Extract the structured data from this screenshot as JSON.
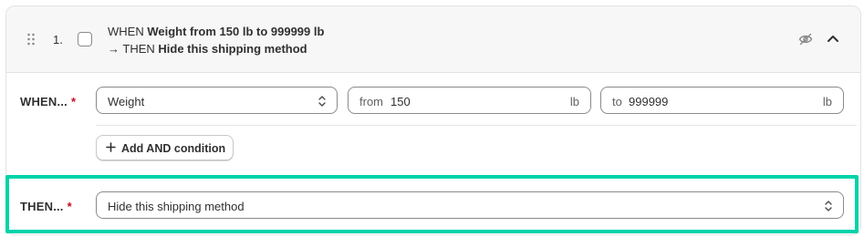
{
  "rule": {
    "number": "1.",
    "summary_when_prefix": "WHEN",
    "summary_when_bold": "Weight from 150 lb to 999999 lb",
    "summary_then_prefix": "→ THEN",
    "summary_then_bold": "Hide this shipping method"
  },
  "when": {
    "label": "WHEN...",
    "required_mark": "*",
    "condition_select": "Weight",
    "from_prefix": "from",
    "from_value": "150",
    "from_unit": "lb",
    "to_prefix": "to",
    "to_value": "999999",
    "to_unit": "lb",
    "add_button_label": "Add AND condition"
  },
  "then": {
    "label": "THEN...",
    "required_mark": "*",
    "action_select": "Hide this shipping method"
  },
  "colors": {
    "highlight": "#00d3a9",
    "required": "#c70a24"
  },
  "icons": {
    "drag": "drag-handle-icon",
    "hide": "eye-slash-icon",
    "collapse": "chevron-up-icon",
    "select": "select-arrows-icon",
    "add": "plus-icon"
  }
}
